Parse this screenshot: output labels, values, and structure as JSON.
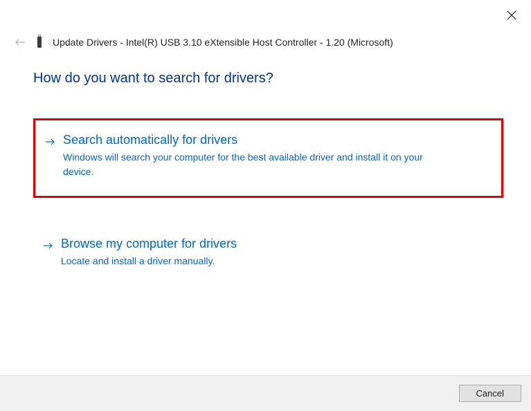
{
  "window": {
    "title": "Update Drivers - Intel(R) USB 3.10 eXtensible Host Controller - 1.20 (Microsoft)"
  },
  "question": "How do you want to search for drivers?",
  "options": [
    {
      "title": "Search automatically for drivers",
      "description": "Windows will search your computer for the best available driver and install it on your device."
    },
    {
      "title": "Browse my computer for drivers",
      "description": "Locate and install a driver manually."
    }
  ],
  "footer": {
    "cancel_label": "Cancel"
  }
}
